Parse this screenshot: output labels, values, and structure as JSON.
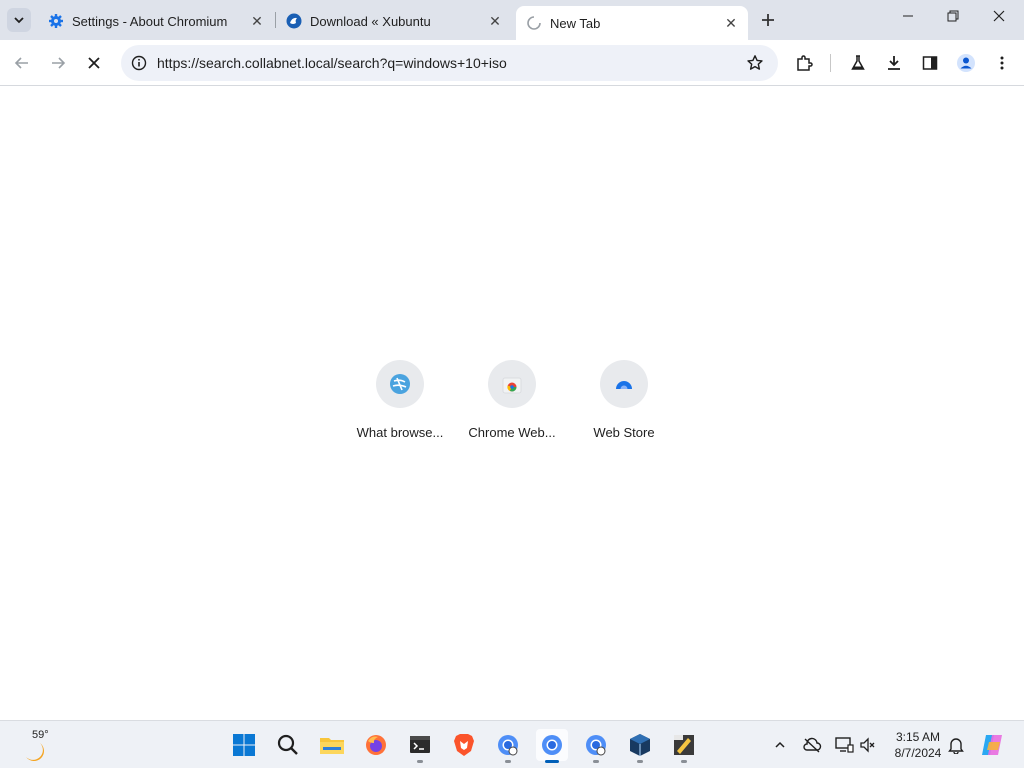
{
  "tabs": [
    {
      "title": "Settings - About Chromium",
      "icon": "gear-icon"
    },
    {
      "title": "Download « Xubuntu",
      "icon": "xubuntu-icon"
    },
    {
      "title": "New Tab",
      "icon": "loading-spinner-icon",
      "active": true
    }
  ],
  "omnibox": {
    "url": "https://search.collabnet.local/search?q=windows+10+iso"
  },
  "shortcuts": [
    {
      "label": "What browse...",
      "icon": "globe-icon"
    },
    {
      "label": "Chrome Web...",
      "icon": "chrome-web-store-icon"
    },
    {
      "label": "Web Store",
      "icon": "web-store-icon"
    }
  ],
  "weather": {
    "temp": "59°"
  },
  "clock": {
    "time": "3:15 AM",
    "date": "8/7/2024"
  },
  "colors": {
    "accent": "#005fb8",
    "tabstrip": "#dfe3eb",
    "omnibox": "#eef1f8"
  }
}
